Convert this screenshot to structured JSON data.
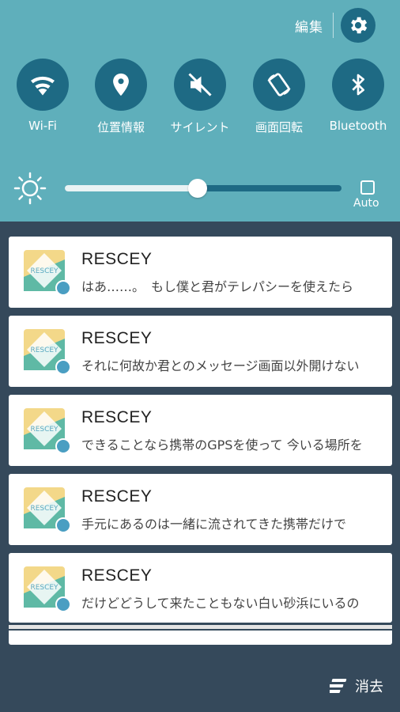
{
  "header": {
    "edit_label": "編集"
  },
  "toggles": [
    {
      "label": "Wi-Fi",
      "icon": "wifi-icon"
    },
    {
      "label": "位置情報",
      "icon": "location-icon"
    },
    {
      "label": "サイレント",
      "icon": "silent-icon"
    },
    {
      "label": "画面回転",
      "icon": "rotate-icon"
    },
    {
      "label": "Bluetooth",
      "icon": "bluetooth-icon"
    }
  ],
  "brightness": {
    "level": 0.48,
    "auto_label": "Auto"
  },
  "notifications": [
    {
      "app": "RESCEY",
      "text": "はあ……。　もし僕と君がテレパシーを使えたら"
    },
    {
      "app": "RESCEY",
      "text": "それに何故か君とのメッセージ画面以外開けない"
    },
    {
      "app": "RESCEY",
      "text": "できることなら携帯のGPSを使って 今いる場所を"
    },
    {
      "app": "RESCEY",
      "text": "手元にあるのは一緒に流されてきた携帯だけで"
    },
    {
      "app": "RESCEY",
      "text": "だけどどうして来たこともない白い砂浜にいるの"
    }
  ],
  "footer": {
    "clear_label": "消去"
  },
  "colors": {
    "panel": "#5fafbb",
    "toggle": "#1e6a84",
    "background": "#35495b"
  }
}
